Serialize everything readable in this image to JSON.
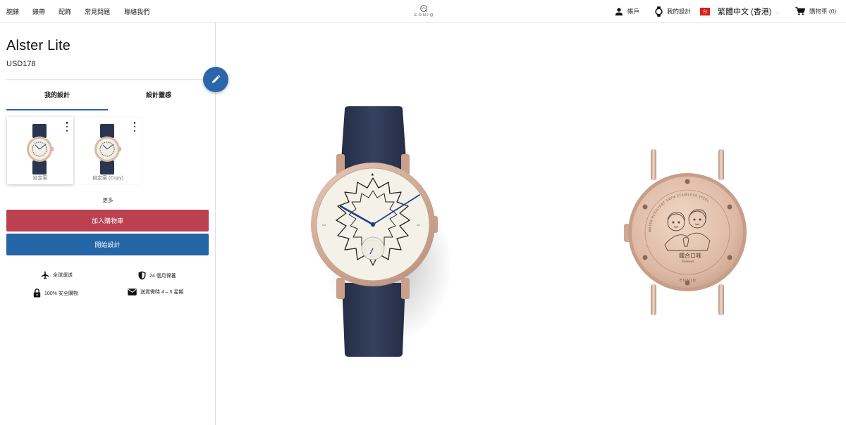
{
  "nav": {
    "links": [
      "腕錶",
      "錶帶",
      "配飾",
      "常見問題",
      "聯絡我們"
    ],
    "logo_text": "EONIQ",
    "account": "帳戶",
    "my_designs": "我的設計",
    "language": "繁體中文 (香港)",
    "cart": "購物車 (0)"
  },
  "product": {
    "title": "Alster Lite",
    "price": "USD178"
  },
  "tabs": [
    "我的設計",
    "設計靈感"
  ],
  "designs": [
    {
      "label": "自定案"
    },
    {
      "label": "自定案 (Copy)"
    }
  ],
  "more": "更多",
  "buttons": {
    "add_to_cart": "加入購物車",
    "start_design": "開始設計"
  },
  "features": [
    "全球運送",
    "24 個月保養",
    "100% 安全購物",
    "送貨需時 4 – 5 星期"
  ],
  "caseback": {
    "engraving_cn": "鍾合口味",
    "engraving_en": "Forever",
    "ring_text": "WATER RESISTANT 5ATM   STAINLESS STEEL"
  },
  "colors": {
    "accent_blue": "#2b66ad",
    "cart_red": "#bb4151",
    "strap_navy": "#2a3550",
    "rose_gold": "#d9b8a6"
  }
}
